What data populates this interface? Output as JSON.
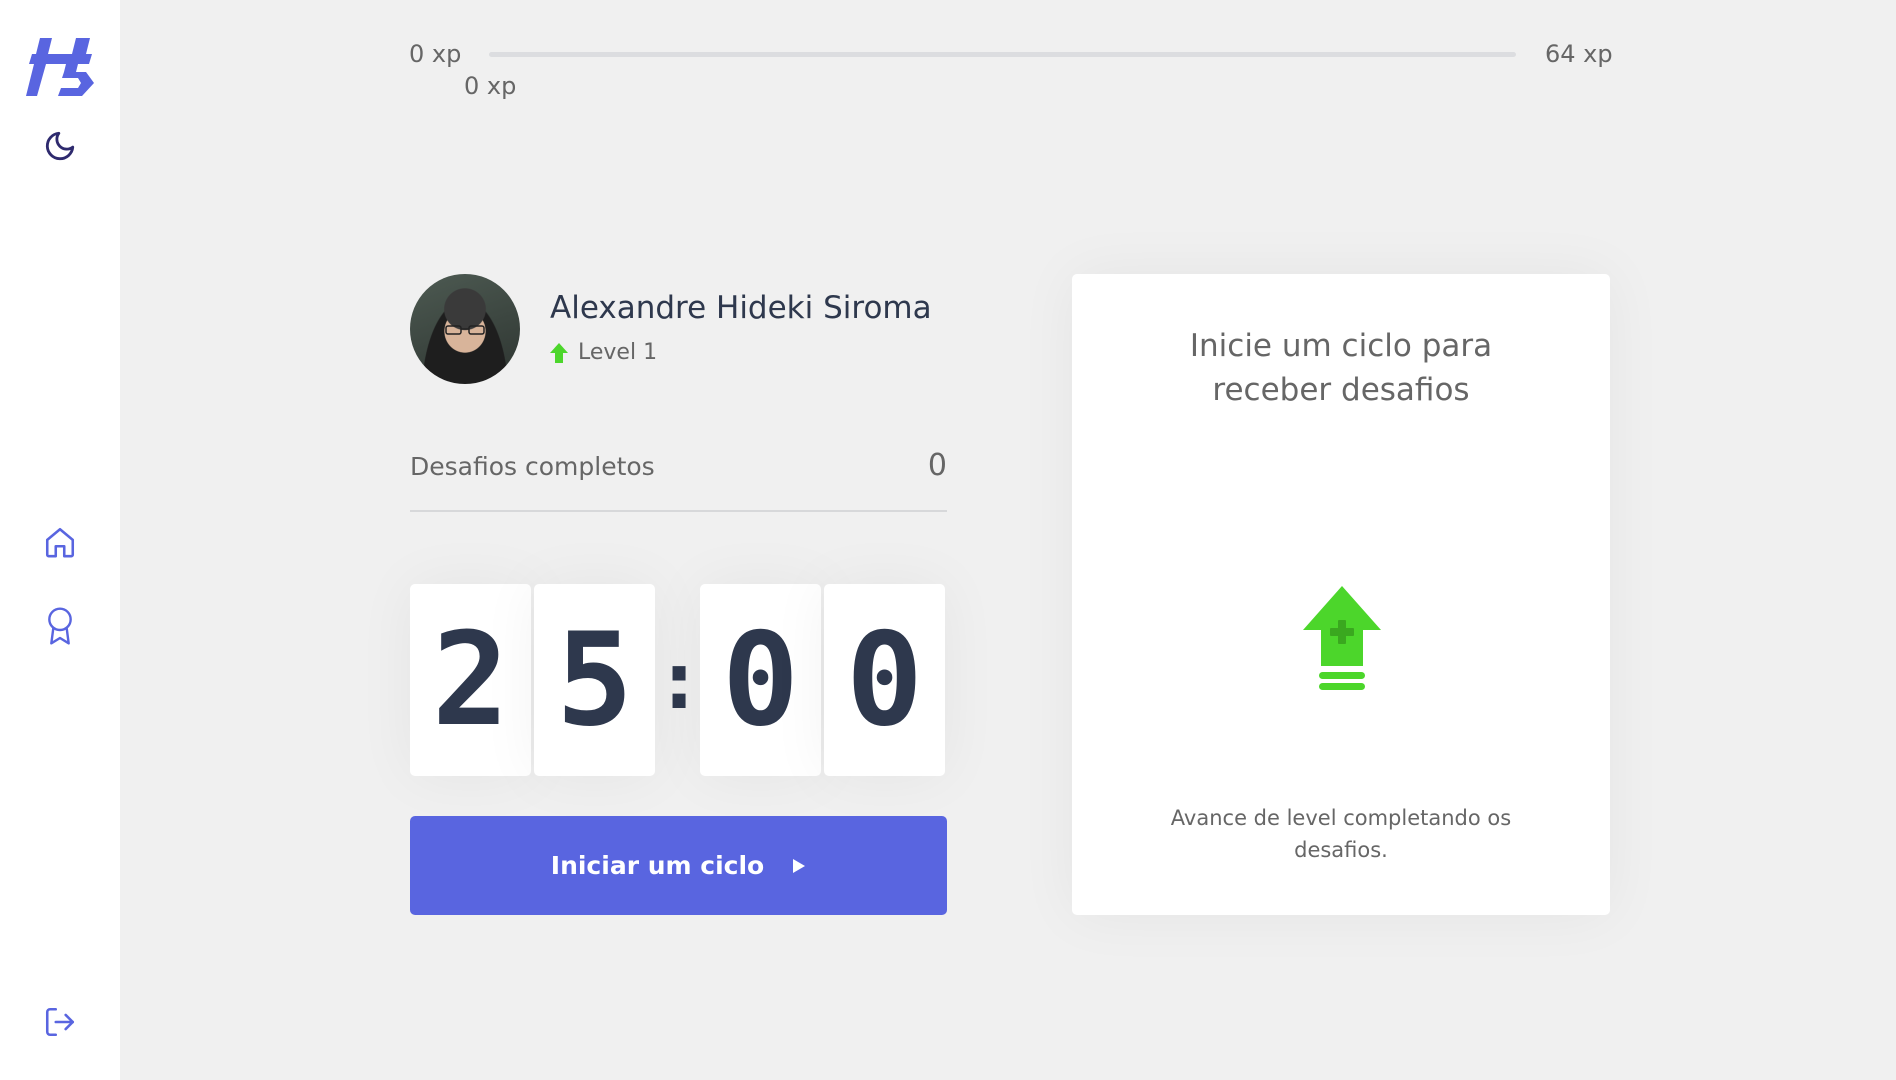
{
  "sidebar": {
    "logo_icon": "move-it-logo-icon",
    "theme_icon": "moon-icon",
    "nav": [
      {
        "id": "home",
        "icon": "home-icon"
      },
      {
        "id": "leaderboard",
        "icon": "award-icon"
      }
    ],
    "logout_icon": "logout-icon",
    "accent_color": "#5965e0"
  },
  "experience_bar": {
    "min_label": "0 xp",
    "current_label": "0 xp",
    "max_label": "64 xp",
    "progress_fraction": 0
  },
  "profile": {
    "name": "Alexandre Hideki Siroma",
    "level_label": "Level 1",
    "level_icon": "level-up-arrow-icon"
  },
  "completed_challenges": {
    "label": "Desafios completos",
    "count": "0"
  },
  "countdown": {
    "minute_left": "2",
    "minute_right": "5",
    "separator": ":",
    "second_left": "0",
    "second_right": "0"
  },
  "start_button": {
    "label": "Iniciar um ciclo",
    "icon": "play-icon"
  },
  "challenge_box": {
    "title": "Inicie um ciclo para receber desafios",
    "icon": "level-up-icon",
    "hint": "Avance de level completando os desafios."
  },
  "colors": {
    "background": "#f0f0f0",
    "primary": "#5965e0",
    "green": "#4cd62b",
    "title": "#2e384d",
    "text": "#666666"
  }
}
